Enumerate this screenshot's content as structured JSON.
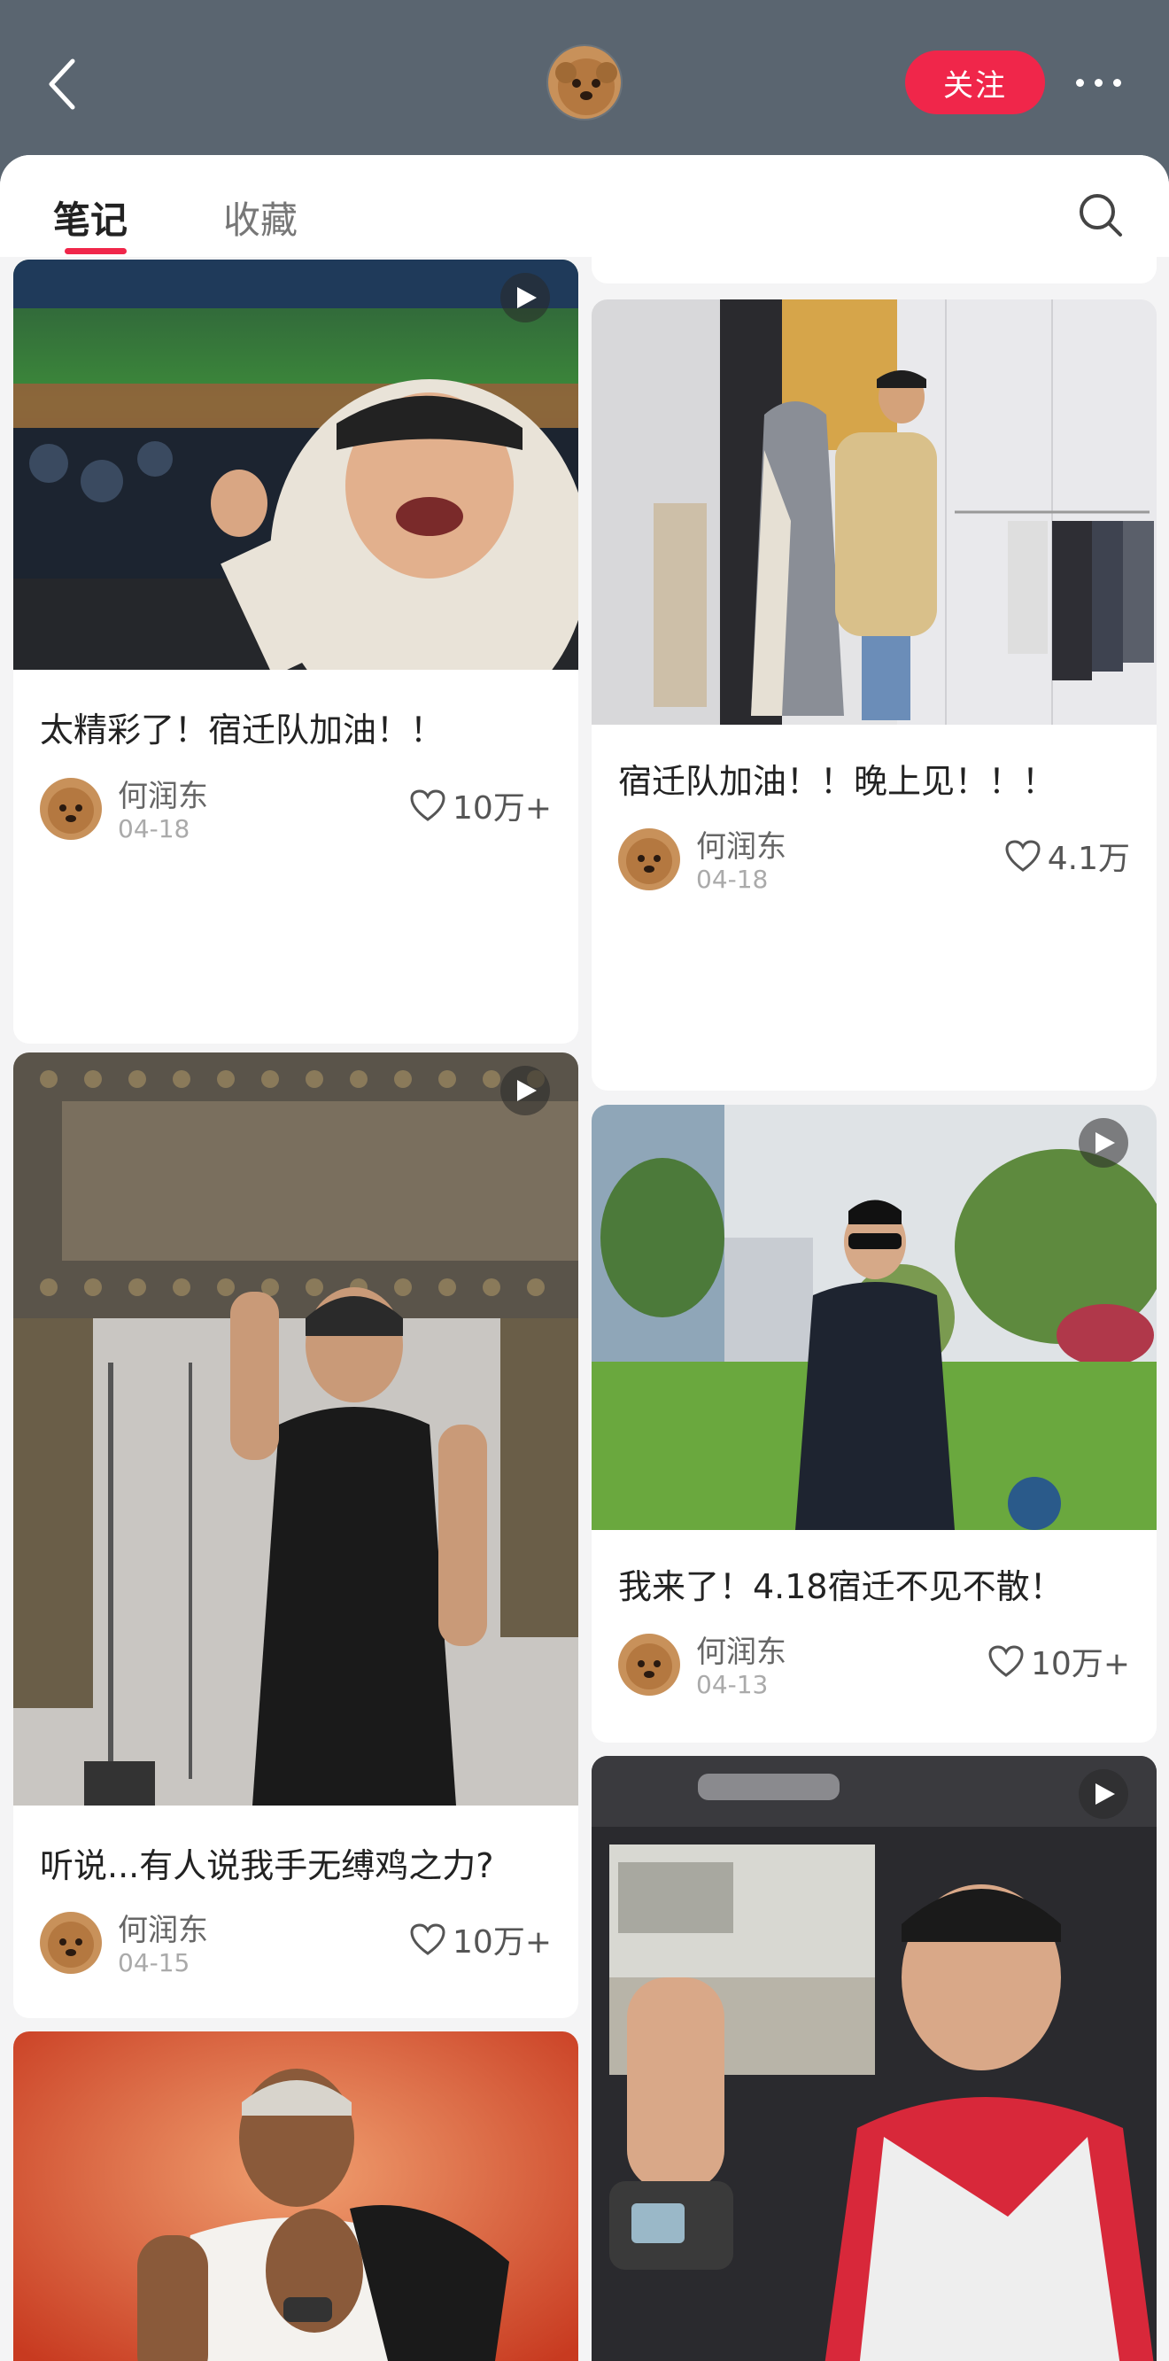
{
  "header": {
    "follow_label": "关注"
  },
  "tabs": [
    {
      "label": "笔记"
    },
    {
      "label": "收藏"
    }
  ],
  "cards": [
    {
      "title": "太精彩了！宿迁队加油！！",
      "author": "何润东",
      "date": "04-18",
      "likes": "10万+",
      "video": true
    },
    {
      "title": "宿迁队加油！！晚上见！！！",
      "author": "何润东",
      "date": "04-18",
      "likes": "4.1万",
      "video": false
    },
    {
      "title": "听说...有人说我手无缚鸡之力?",
      "author": "何润东",
      "date": "04-15",
      "likes": "10万+",
      "video": true
    },
    {
      "title": "我来了！4.18宿迁不见不散！",
      "author": "何润东",
      "date": "04-13",
      "likes": "10万+",
      "video": true
    }
  ],
  "colors": {
    "accent": "#f0264a",
    "header_bg": "#5a6570"
  }
}
